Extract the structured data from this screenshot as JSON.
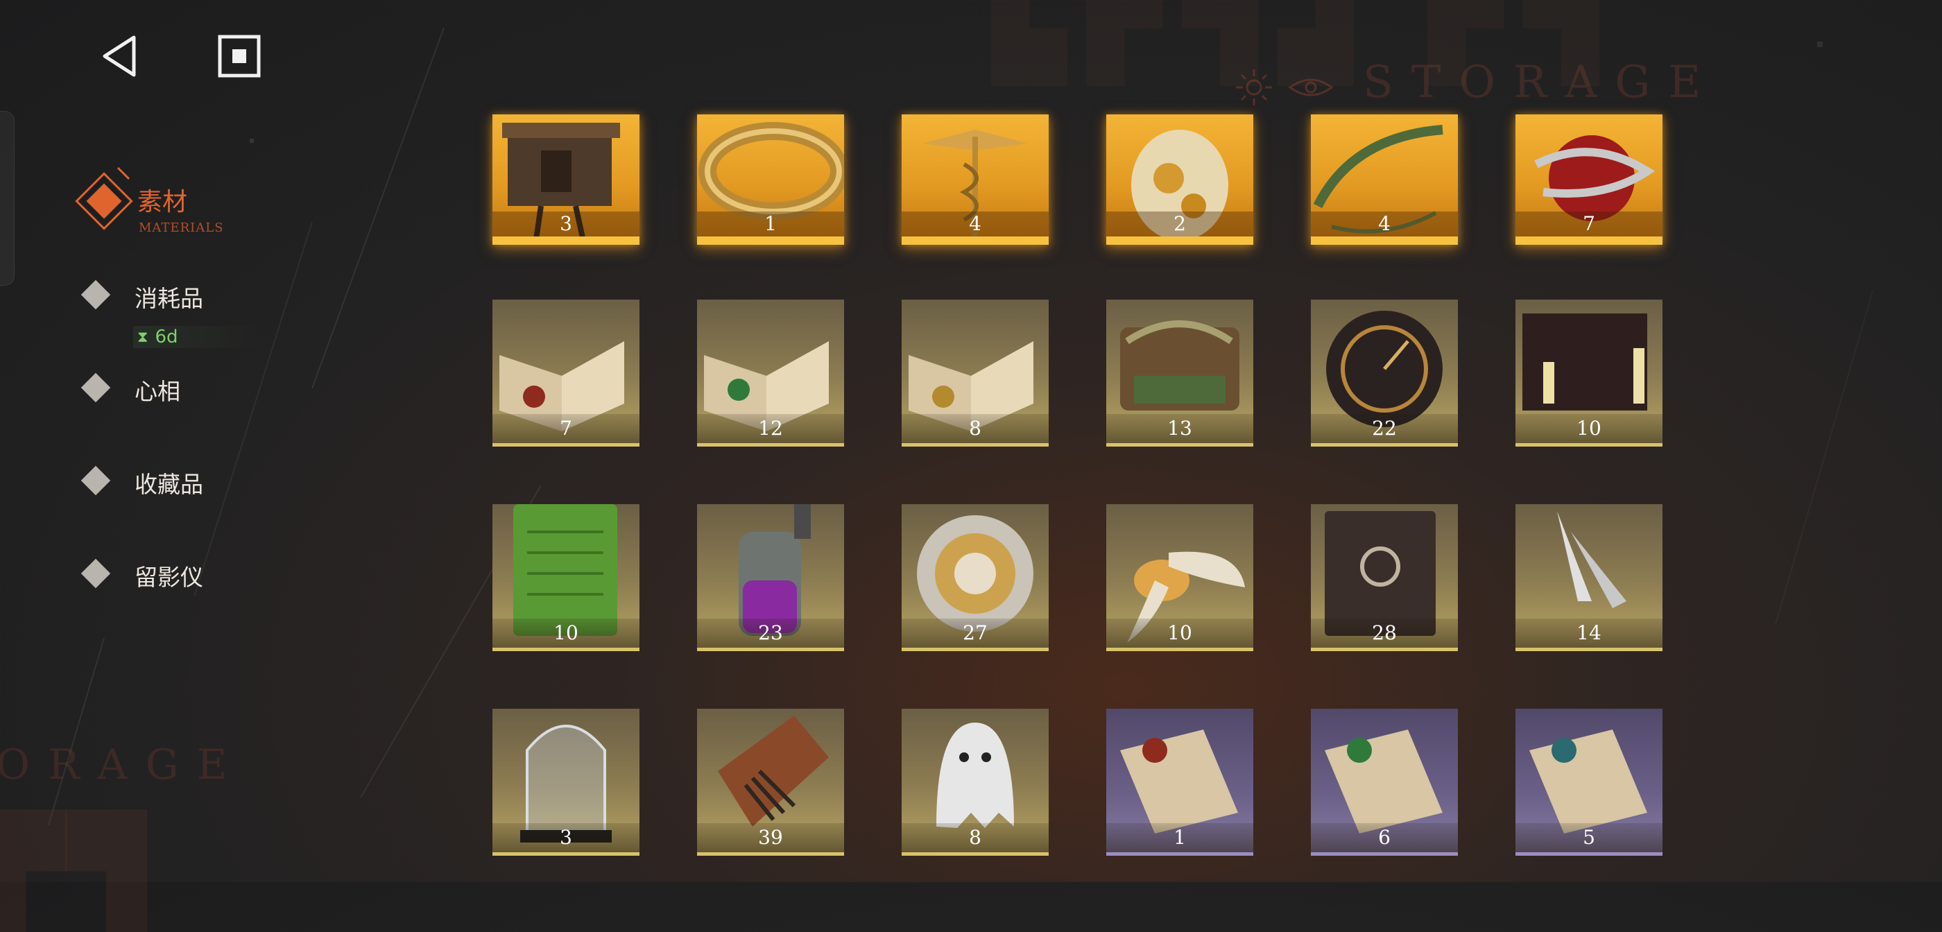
{
  "nav": {
    "back_icon": "back-triangle-icon",
    "home_icon": "square-stop-icon"
  },
  "background": {
    "storage_word_top": "STORAGE",
    "storage_word_left": "ORAGE"
  },
  "categories": {
    "active": {
      "label": "素材",
      "sub": "MATERIALS"
    },
    "items": [
      {
        "label": "消耗品"
      },
      {
        "label": "心相"
      },
      {
        "label": "收藏品"
      },
      {
        "label": "留影仪"
      }
    ],
    "timer": {
      "icon": "hourglass-icon",
      "value": "6d"
    }
  },
  "colors": {
    "accent": "#e0642e",
    "timer": "#7fd06a",
    "gold_frame": "#f3b436",
    "yellow_frame": "#d9c36a",
    "purple_frame": "#9c8ec0"
  },
  "items": [
    {
      "name": "hut-on-legs",
      "count": "3",
      "rarity": "gold"
    },
    {
      "name": "golden-ring",
      "count": "1",
      "rarity": "gold"
    },
    {
      "name": "caduceus",
      "count": "4",
      "rarity": "gold"
    },
    {
      "name": "spotted-creature",
      "count": "2",
      "rarity": "gold"
    },
    {
      "name": "laurel-wreath",
      "count": "4",
      "rarity": "gold"
    },
    {
      "name": "apple-with-snake",
      "count": "7",
      "rarity": "gold"
    },
    {
      "name": "book-red-emblem",
      "count": "7",
      "rarity": "yellow"
    },
    {
      "name": "book-green-emblem",
      "count": "12",
      "rarity": "yellow"
    },
    {
      "name": "book-gold-emblem",
      "count": "8",
      "rarity": "yellow"
    },
    {
      "name": "overgrown-chest",
      "count": "13",
      "rarity": "yellow"
    },
    {
      "name": "astrolabe-clock",
      "count": "22",
      "rarity": "yellow"
    },
    {
      "name": "ouija-board",
      "count": "10",
      "rarity": "yellow"
    },
    {
      "name": "green-tablet",
      "count": "10",
      "rarity": "yellow"
    },
    {
      "name": "potion-bottle",
      "count": "23",
      "rarity": "yellow"
    },
    {
      "name": "pocket-watch",
      "count": "27",
      "rarity": "yellow"
    },
    {
      "name": "glowing-moth",
      "count": "10",
      "rarity": "yellow"
    },
    {
      "name": "leather-tome",
      "count": "28",
      "rarity": "yellow"
    },
    {
      "name": "silver-bullets",
      "count": "14",
      "rarity": "yellow"
    },
    {
      "name": "bell-jar",
      "count": "3",
      "rarity": "yellow"
    },
    {
      "name": "box-with-hand",
      "count": "39",
      "rarity": "yellow"
    },
    {
      "name": "sheet-ghost",
      "count": "8",
      "rarity": "yellow"
    },
    {
      "name": "scroll-red-emblem",
      "count": "1",
      "rarity": "purple"
    },
    {
      "name": "scroll-green-emblem",
      "count": "6",
      "rarity": "purple"
    },
    {
      "name": "scroll-teal-emblem",
      "count": "5",
      "rarity": "purple"
    }
  ]
}
